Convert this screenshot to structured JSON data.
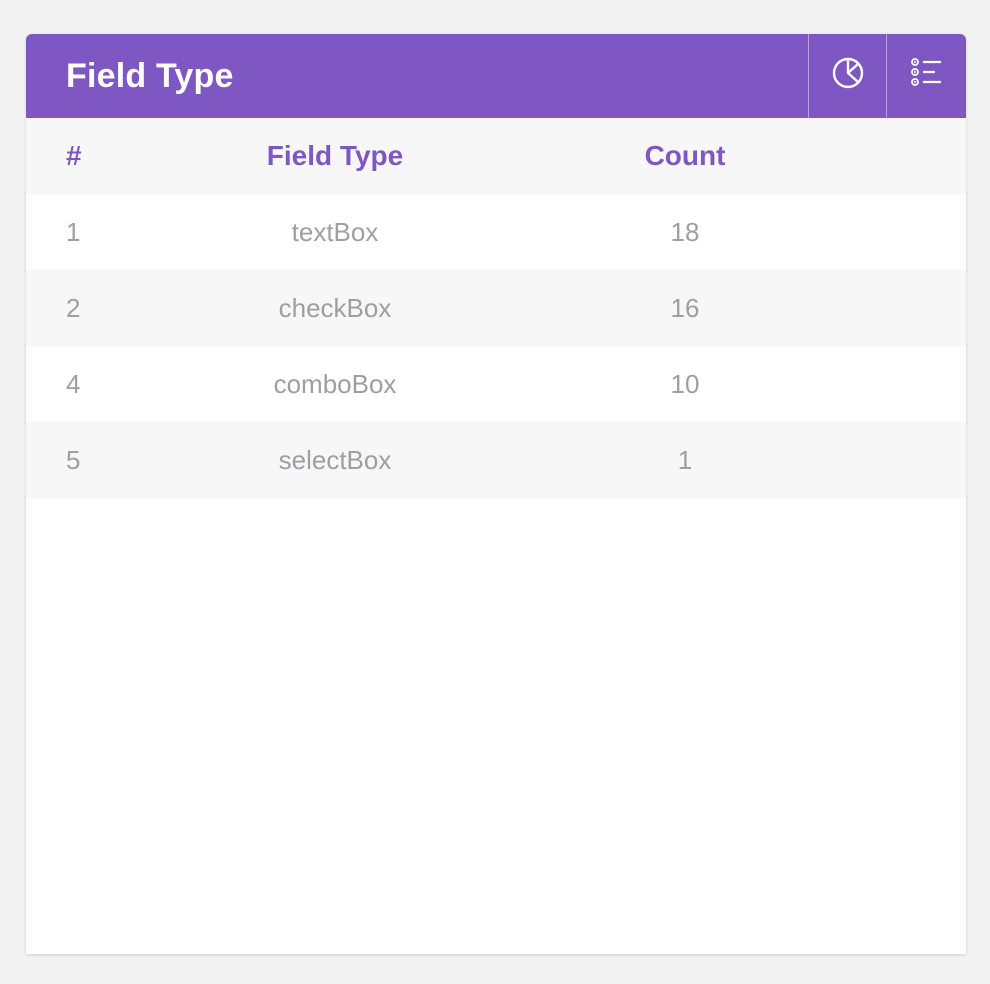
{
  "card": {
    "title": "Field Type"
  },
  "header_buttons": {
    "chart_icon": "pie-chart-icon",
    "list_icon": "list-icon"
  },
  "colors": {
    "accent": "#7e57c2",
    "cell_text": "#9e9ea3",
    "row_alt": "#f7f7f7"
  },
  "table": {
    "columns": [
      "#",
      "Field Type",
      "Count"
    ],
    "rows": [
      {
        "num": "1",
        "type": "textBox",
        "count": "18"
      },
      {
        "num": "2",
        "type": "checkBox",
        "count": "16"
      },
      {
        "num": "4",
        "type": "comboBox",
        "count": "10"
      },
      {
        "num": "5",
        "type": "selectBox",
        "count": "1"
      }
    ]
  }
}
